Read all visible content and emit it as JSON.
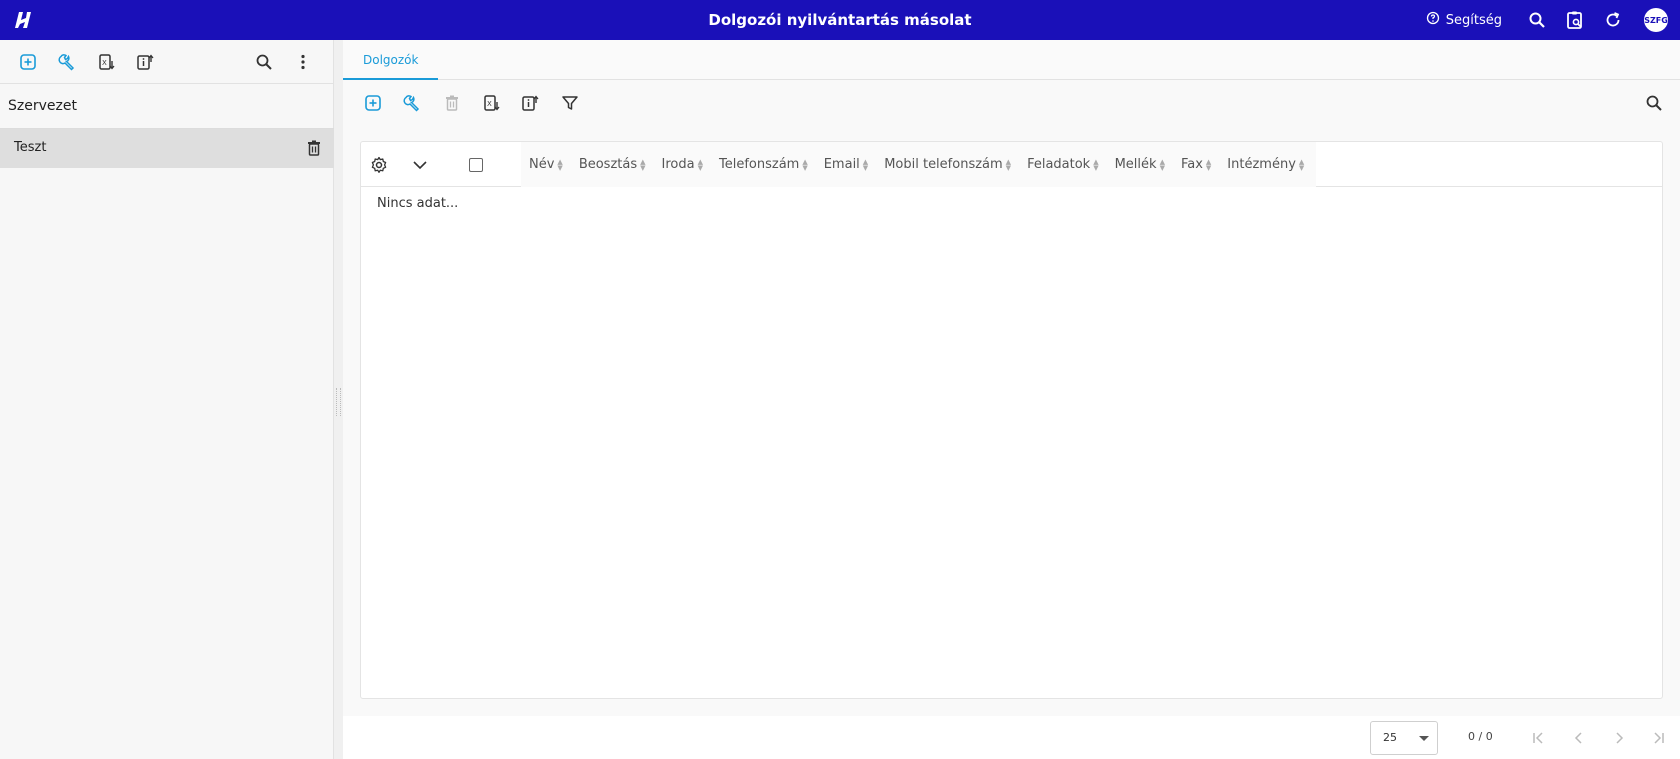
{
  "header": {
    "title": "Dolgozói nyilvántartás másolat",
    "help_label": "Segítség",
    "avatar_initials": "SZFG",
    "brand_color": "#1a10b8",
    "icons": [
      "app-logo-icon",
      "help-circle-icon",
      "search-icon",
      "clipboard-search-icon",
      "refresh-icon"
    ]
  },
  "left_panel": {
    "toolbar_icons": [
      "add-icon",
      "wrench-icon",
      "excel-export-icon",
      "info-export-icon",
      "search-icon",
      "more-vertical-icon"
    ],
    "heading": "Szervezet",
    "items": [
      {
        "label": "Teszt",
        "selected": true
      }
    ]
  },
  "main": {
    "tabs": [
      {
        "label": "Dolgozók",
        "active": true
      }
    ],
    "toolbar_icons": [
      "add-icon",
      "wrench-icon",
      "delete-icon",
      "excel-export-icon",
      "info-export-icon",
      "filter-icon",
      "search-icon"
    ],
    "accent_color": "#1a9bd8",
    "grid": {
      "columns": [
        "Név",
        "Beosztás",
        "Iroda",
        "Telefonszám",
        "Email",
        "Mobil telefonszám",
        "Feladatok",
        "Mellék",
        "Fax",
        "Intézmény"
      ],
      "rows": [],
      "empty_text": "Nincs adat..."
    },
    "pagination": {
      "page_size": "25",
      "info": "0 / 0"
    }
  }
}
